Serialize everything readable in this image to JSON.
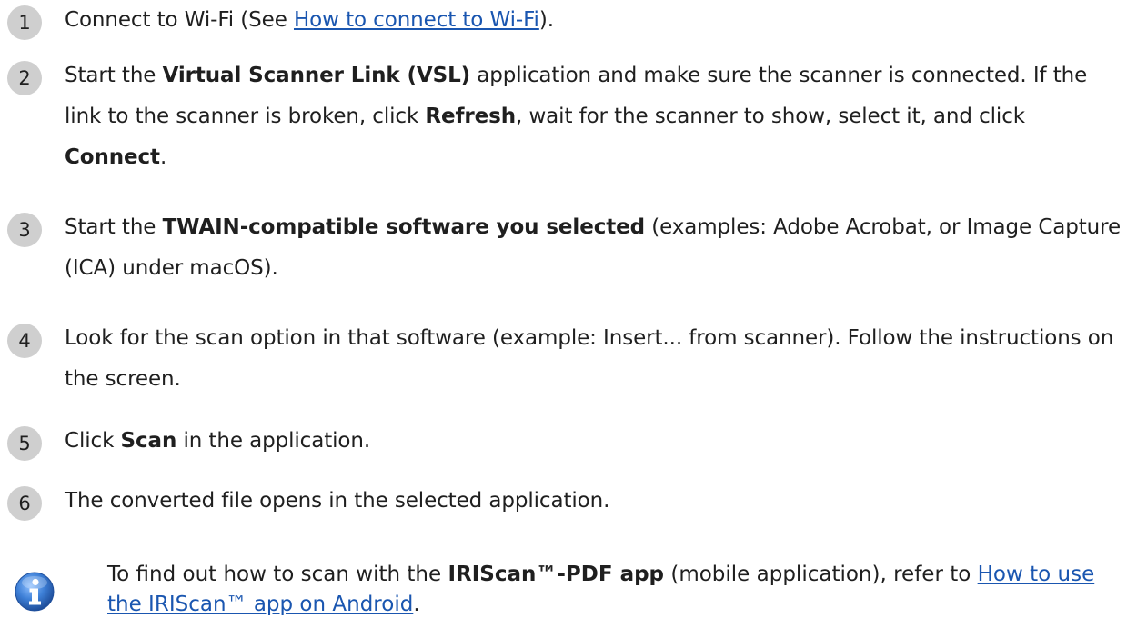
{
  "steps": [
    {
      "number": "1",
      "parts": [
        {
          "t": "text",
          "v": "Connect to Wi-Fi (See "
        },
        {
          "t": "link",
          "v": "How to connect to Wi-Fi"
        },
        {
          "t": "text",
          "v": ")."
        }
      ]
    },
    {
      "number": "2",
      "parts": [
        {
          "t": "text",
          "v": "Start the "
        },
        {
          "t": "bold",
          "v": "Virtual Scanner Link (VSL)"
        },
        {
          "t": "text",
          "v": " application and make sure the scanner is connected. If the link to the scanner is broken, click "
        },
        {
          "t": "bold",
          "v": "Refresh"
        },
        {
          "t": "text",
          "v": ", wait for the scanner to show, select it, and click "
        },
        {
          "t": "bold",
          "v": "Connect"
        },
        {
          "t": "text",
          "v": "."
        }
      ]
    },
    {
      "number": "3",
      "parts": [
        {
          "t": "text",
          "v": "Start the "
        },
        {
          "t": "bold",
          "v": "TWAIN-compatible software you selected"
        },
        {
          "t": "text",
          "v": " (examples: Adobe Acrobat, or Image Capture (ICA) under macOS)."
        }
      ]
    },
    {
      "number": "4",
      "parts": [
        {
          "t": "text",
          "v": "Look for the scan option in that software (example: Insert... from scanner).  Follow the instructions on the screen."
        }
      ]
    },
    {
      "number": "5",
      "parts": [
        {
          "t": "text",
          "v": "Click "
        },
        {
          "t": "bold",
          "v": "Scan"
        },
        {
          "t": "text",
          "v": " in the application."
        }
      ]
    },
    {
      "number": "6",
      "parts": [
        {
          "t": "text",
          "v": "The converted file opens in the selected application."
        }
      ]
    }
  ],
  "note": {
    "icon": "info-icon",
    "parts": [
      {
        "t": "text",
        "v": "To find out how to scan with the "
      },
      {
        "t": "bold",
        "v": "IRIScan™-PDF app"
      },
      {
        "t": "text",
        "v": " (mobile application), refer to "
      },
      {
        "t": "link",
        "v": "How to use the IRIScan™ app on Android"
      },
      {
        "t": "text",
        "v": "."
      }
    ]
  },
  "colors": {
    "link": "#1a56b0",
    "number_circle": "#cfcfcf",
    "info_icon_blue": "#2f6fc9"
  }
}
